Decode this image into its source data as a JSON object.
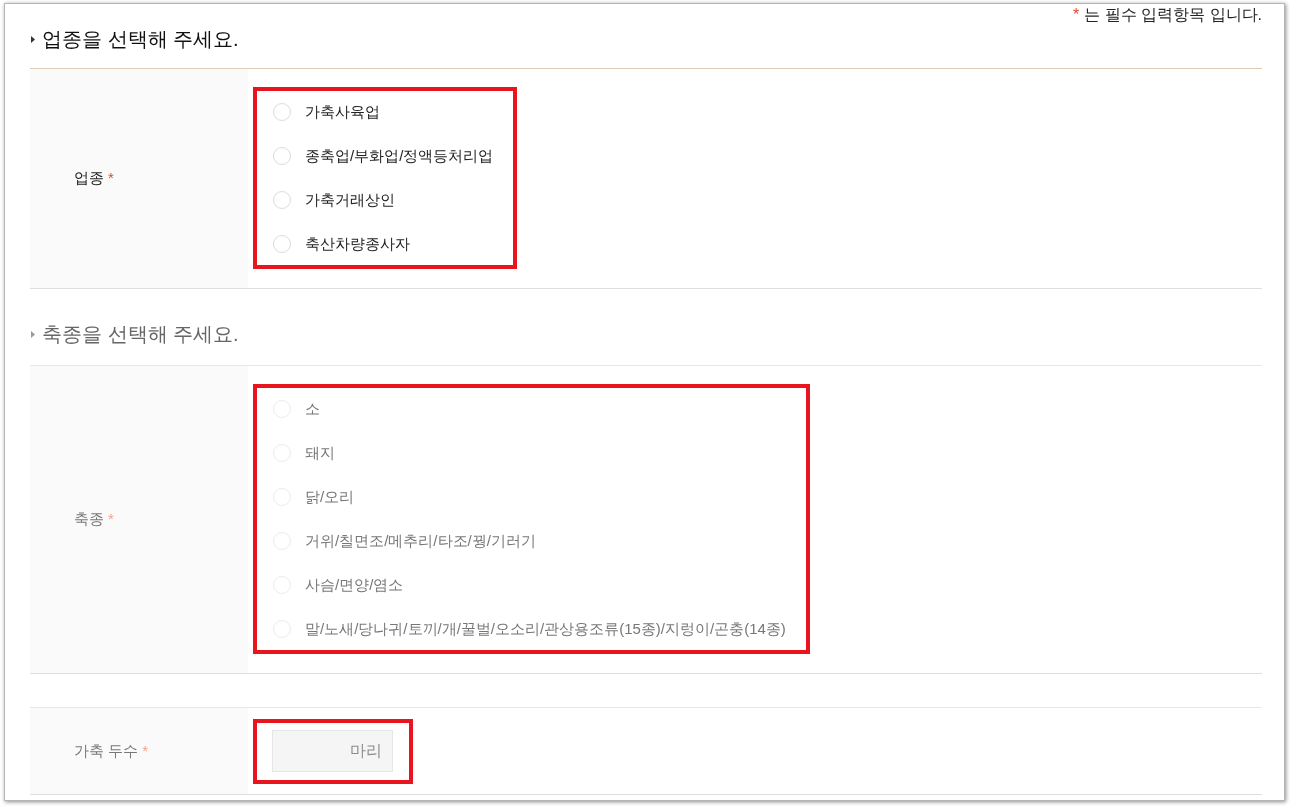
{
  "required_note": {
    "mark": "*",
    "text": "는 필수 입력항목 입니다."
  },
  "sections": [
    {
      "heading": "업종을 선택해 주세요.",
      "disabled": false,
      "fields": [
        {
          "kind": "radio_group",
          "label": "업종",
          "required_mark": "*",
          "highlighted": true,
          "options": [
            {
              "label": "가축사육업",
              "selected": false
            },
            {
              "label": "종축업/부화업/정액등처리업",
              "selected": false
            },
            {
              "label": "가축거래상인",
              "selected": false
            },
            {
              "label": "축산차량종사자",
              "selected": false
            }
          ]
        }
      ]
    },
    {
      "heading": "축종을 선택해 주세요.",
      "disabled": true,
      "fields": [
        {
          "kind": "radio_group",
          "label": "축종",
          "required_mark": "*",
          "highlighted": true,
          "options": [
            {
              "label": "소",
              "selected": false
            },
            {
              "label": "돼지",
              "selected": false
            },
            {
              "label": "닭/오리",
              "selected": false
            },
            {
              "label": "거위/칠면조/메추리/타조/꿩/기러기",
              "selected": false
            },
            {
              "label": "사슴/면양/염소",
              "selected": false
            },
            {
              "label": "말/노새/당나귀/토끼/개/꿀벌/오소리/관상용조류(15종)/지렁이/곤충(14종)",
              "selected": false
            }
          ]
        }
      ]
    },
    {
      "disabled": true,
      "fields": [
        {
          "kind": "number_input",
          "label": "가축 두수",
          "required_mark": "*",
          "highlighted": true,
          "placeholder": "마리"
        }
      ]
    }
  ]
}
